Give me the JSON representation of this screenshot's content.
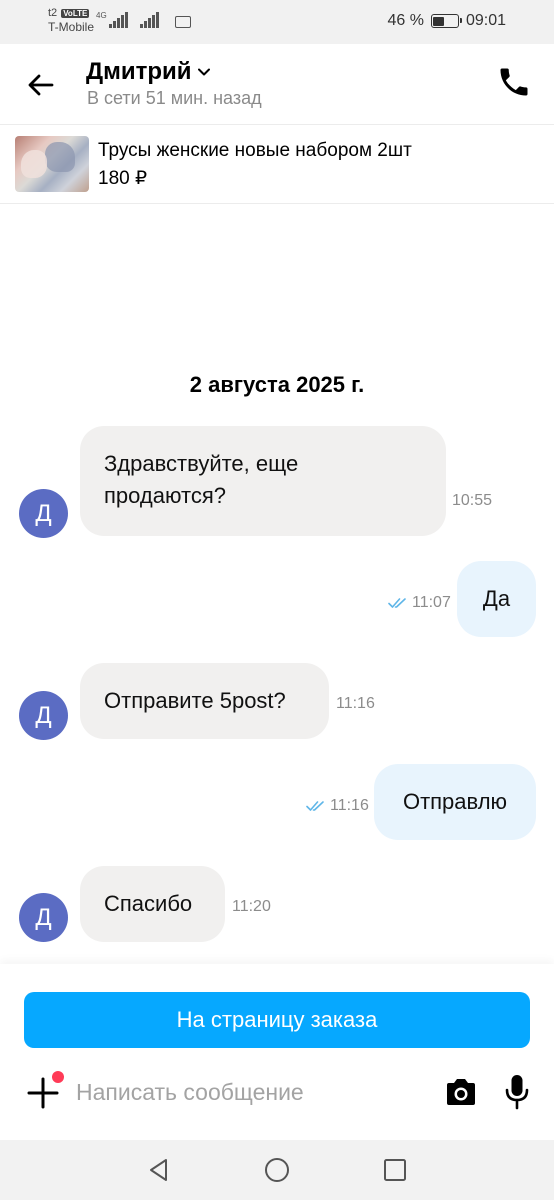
{
  "status_bar": {
    "carrier_tag": "t2",
    "volte": "VoLTE",
    "network": "4G",
    "carrier": "T-Mobile",
    "battery": "46 %",
    "battery_level": 0.46,
    "time": "09:01"
  },
  "header": {
    "contact_name": "Дмитрий",
    "contact_status": "В сети 51 мин. назад",
    "icons": [
      "back-arrow-icon",
      "chevron-down-icon",
      "phone-icon"
    ]
  },
  "product": {
    "title": "Трусы женские новые набором 2шт",
    "price": "180 ₽"
  },
  "chat": {
    "date_separator": "2 августа 2025 г.",
    "messages": [
      {
        "direction": "in",
        "avatar": "Д",
        "text": "Здравствуйте, еще продаются?",
        "time": "10:55"
      },
      {
        "direction": "out",
        "text": "Да",
        "time": "11:07",
        "read": true
      },
      {
        "direction": "in",
        "avatar": "Д",
        "text": "Отправите 5post?",
        "time": "11:16"
      },
      {
        "direction": "out",
        "text": "Отправлю",
        "time": "11:16",
        "read": true
      },
      {
        "direction": "in",
        "avatar": "Д",
        "text": "Спасибо",
        "time": "11:20"
      }
    ]
  },
  "composer": {
    "order_button": "На страницу заказа",
    "placeholder": "Написать сообщение",
    "value": "",
    "icons": [
      "plus-icon",
      "camera-icon",
      "microphone-icon"
    ]
  },
  "colors": {
    "accent": "#06a8ff",
    "avatar": "#5b6cc3",
    "incoming_bubble": "#f1f0ef",
    "outgoing_bubble": "#e8f4fd",
    "read_ticks": "#5fb6e8",
    "notification_dot": "#ff3b57"
  }
}
